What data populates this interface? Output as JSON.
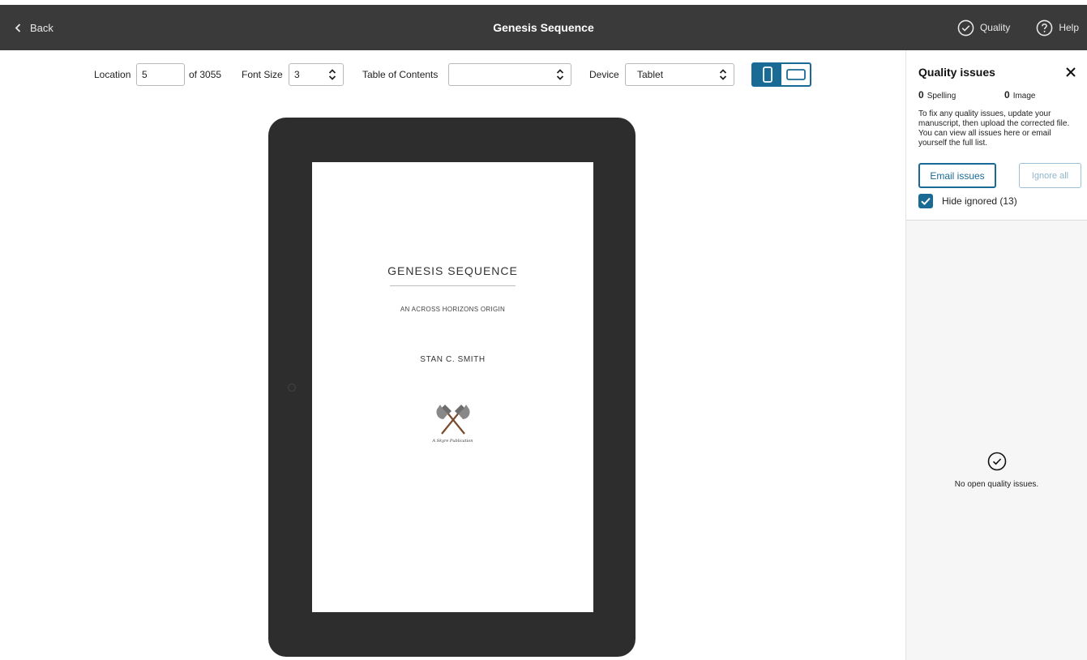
{
  "topbar": {
    "back_label": "Back",
    "title": "Genesis Sequence",
    "quality_label": "Quality",
    "help_label": "Help"
  },
  "toolbar": {
    "location_label": "Location",
    "location_value": "5",
    "location_total": "of 3055",
    "font_size_label": "Font Size",
    "font_size_value": "3",
    "toc_label": "Table of Contents",
    "toc_value": "",
    "device_label": "Device",
    "device_value": "Tablet",
    "orientation_selected": "portrait"
  },
  "book": {
    "title": "GENESIS SEQUENCE",
    "subtitle": "AN ACROSS HORIZONS ORIGIN",
    "author": "STAN C. SMITH",
    "publisher_logo_text": "A Skyre Publication"
  },
  "quality_panel": {
    "title": "Quality issues",
    "spelling_count": "0",
    "spelling_label": "Spelling",
    "image_count": "0",
    "image_label": "Image",
    "description": "To fix any quality issues, update your manuscript, then upload the corrected file. You can view all issues here or email yourself the full list.",
    "email_button": "Email issues",
    "ignore_button": "Ignore all",
    "hide_ignored_label": "Hide ignored (13)",
    "hide_ignored_checked": true,
    "empty_message": "No open quality issues."
  },
  "colors": {
    "topbar_bg": "#3a3a3a",
    "accent": "#1a6a96",
    "tablet_frame": "#2d2d2d",
    "panel_bg": "#f6f6f6"
  }
}
